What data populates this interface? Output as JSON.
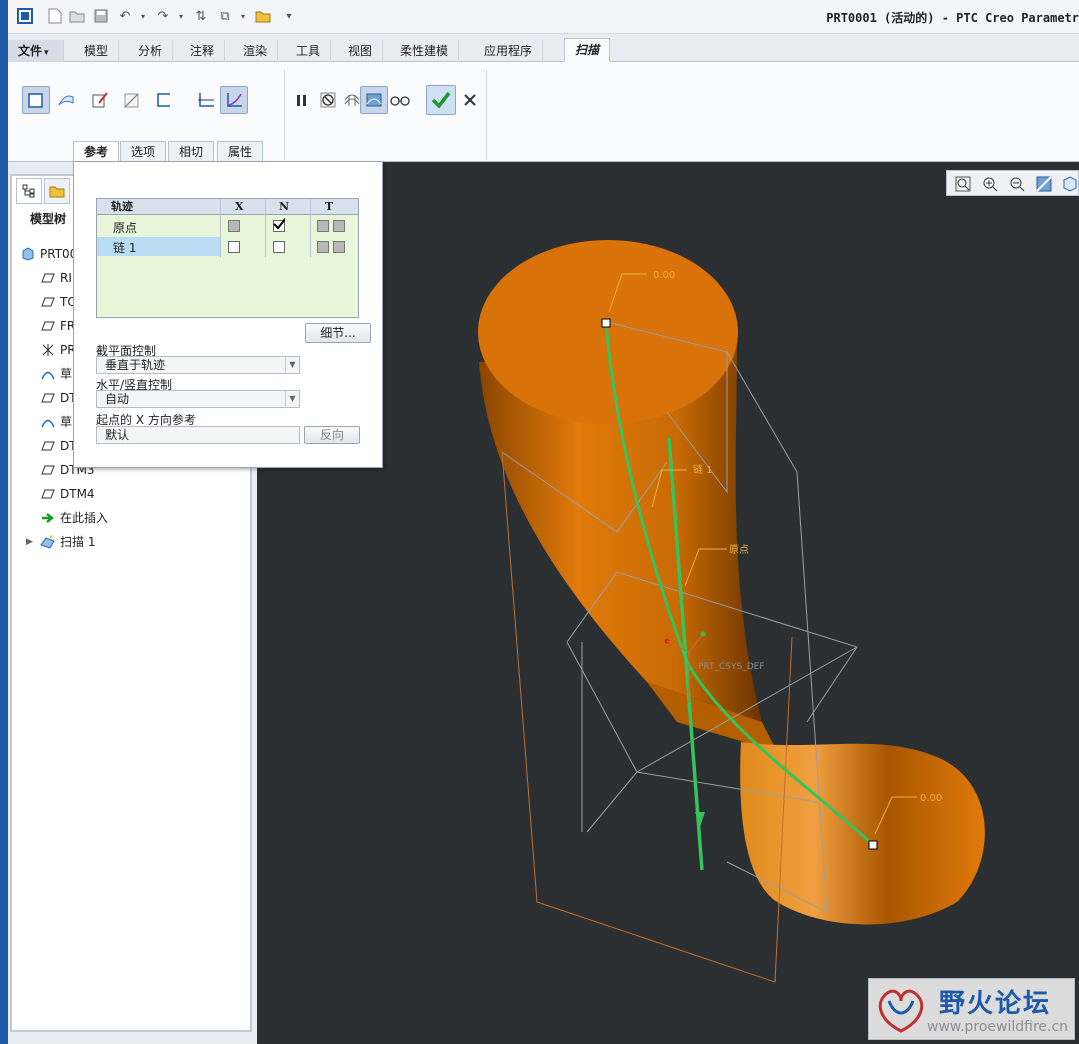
{
  "window": {
    "title": "PRT0001 (活动的) - PTC Creo Parametr"
  },
  "quick_access": [
    "app-icon",
    "new-icon",
    "open-icon",
    "save-icon",
    "undo-icon",
    "redo-icon",
    "regenerate-icon",
    "windows-icon",
    "close-window-icon",
    "customize-icon"
  ],
  "tabs": [
    {
      "label": "文件",
      "dropdown": "▾"
    },
    {
      "label": "模型"
    },
    {
      "label": "分析"
    },
    {
      "label": "注释"
    },
    {
      "label": "渲染"
    },
    {
      "label": "工具"
    },
    {
      "label": "视图"
    },
    {
      "label": "柔性建模"
    },
    {
      "label": "应用程序"
    },
    {
      "label": "扫描"
    }
  ],
  "ribbon": {
    "subtabs": [
      "参考",
      "选项",
      "相切",
      "属性"
    ]
  },
  "model_tree": {
    "title": "模型树",
    "items": [
      {
        "label": "PRT00",
        "icon": "part-icon"
      },
      {
        "label": "RI",
        "icon": "datum-plane-icon"
      },
      {
        "label": "TO",
        "icon": "datum-plane-icon"
      },
      {
        "label": "FR",
        "icon": "datum-plane-icon"
      },
      {
        "label": "PR",
        "icon": "csys-icon"
      },
      {
        "label": "草",
        "icon": "sketch-icon"
      },
      {
        "label": "DT",
        "icon": "datum-plane-icon"
      },
      {
        "label": "草",
        "icon": "sketch-icon"
      },
      {
        "label": "DT",
        "icon": "datum-plane-icon"
      },
      {
        "label": "DTM3",
        "icon": "datum-plane-icon"
      },
      {
        "label": "DTM4",
        "icon": "datum-plane-icon"
      },
      {
        "label": "在此插入",
        "icon": "insert-arrow-icon"
      },
      {
        "label": "扫描 1",
        "icon": "sweep-icon",
        "expander": "▶"
      }
    ]
  },
  "popup": {
    "table": {
      "headers": [
        "轨迹",
        "X",
        "N",
        "T"
      ],
      "rows": [
        {
          "name": "原点",
          "x": "grey",
          "n": "checked",
          "selected": false
        },
        {
          "name": "链 1",
          "x": "empty",
          "n": "empty",
          "selected": true
        }
      ]
    },
    "details_button": "细节...",
    "section_plane_label": "截平面控制",
    "section_plane_value": "垂直于轨迹",
    "hv_control_label": "水平/竖直控制",
    "hv_control_value": "自动",
    "start_x_label": "起点的 X 方向参考",
    "start_x_value": "默认",
    "flip_button": "反向"
  },
  "viewport": {
    "labels": {
      "top_value": "0.00",
      "bottom_value": "0.00",
      "chain_label": "链 1",
      "origin_label": "原点",
      "csys_label": "PRT_CSYS_DEF"
    },
    "colors": {
      "background": "#2b2f31",
      "solid": "#e07a0a",
      "trajectory": "#35c45a"
    }
  },
  "watermark": {
    "title": "野火论坛",
    "url": "www.proewildfire.cn"
  }
}
